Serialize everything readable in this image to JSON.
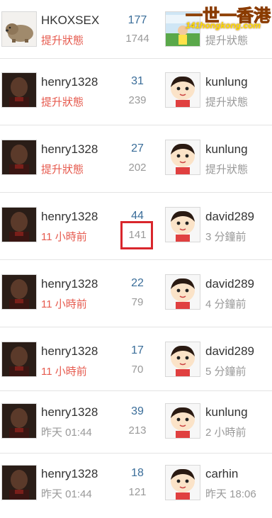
{
  "threads": [
    {
      "poster": "HKOXSEX",
      "status": "提升狀態",
      "status_style": "hot",
      "replies": "177",
      "views": "1744",
      "last_poster": "",
      "last_time": "提升狀態",
      "poster_avatar": "wombat-avatar",
      "last_avatar": "logo-avatar",
      "logo_text": "一世一香港",
      "logo_url": "141hongkong.com"
    },
    {
      "poster": "henry1328",
      "status": "提升狀態",
      "status_style": "hot",
      "replies": "31",
      "views": "239",
      "last_poster": "kunlung",
      "last_time": "提升狀態"
    },
    {
      "poster": "henry1328",
      "status": "提升狀態",
      "status_style": "hot",
      "replies": "27",
      "views": "202",
      "last_poster": "kunlung",
      "last_time": "提升狀態"
    },
    {
      "poster": "henry1328",
      "status": "11 小時前",
      "status_style": "hot",
      "replies": "44",
      "views": "141",
      "last_poster": "david289",
      "last_time": "3 分鐘前"
    },
    {
      "poster": "henry1328",
      "status": "11 小時前",
      "status_style": "hot",
      "replies": "22",
      "views": "79",
      "last_poster": "david289",
      "last_time": "4 分鐘前"
    },
    {
      "poster": "henry1328",
      "status": "11 小時前",
      "status_style": "hot",
      "replies": "17",
      "views": "70",
      "last_poster": "david289",
      "last_time": "5 分鐘前"
    },
    {
      "poster": "henry1328",
      "status": "昨天 01:44",
      "status_style": "old",
      "replies": "39",
      "views": "213",
      "last_poster": "kunlung",
      "last_time": "2 小時前"
    },
    {
      "poster": "henry1328",
      "status": "昨天 01:44",
      "status_style": "old",
      "replies": "18",
      "views": "121",
      "last_poster": "carhin",
      "last_time": "昨天 18:06"
    }
  ],
  "colors": {
    "accent_red": "#e65a4e",
    "count_blue": "#3a6d99",
    "muted": "#999999",
    "highlight": "#d9262c"
  }
}
